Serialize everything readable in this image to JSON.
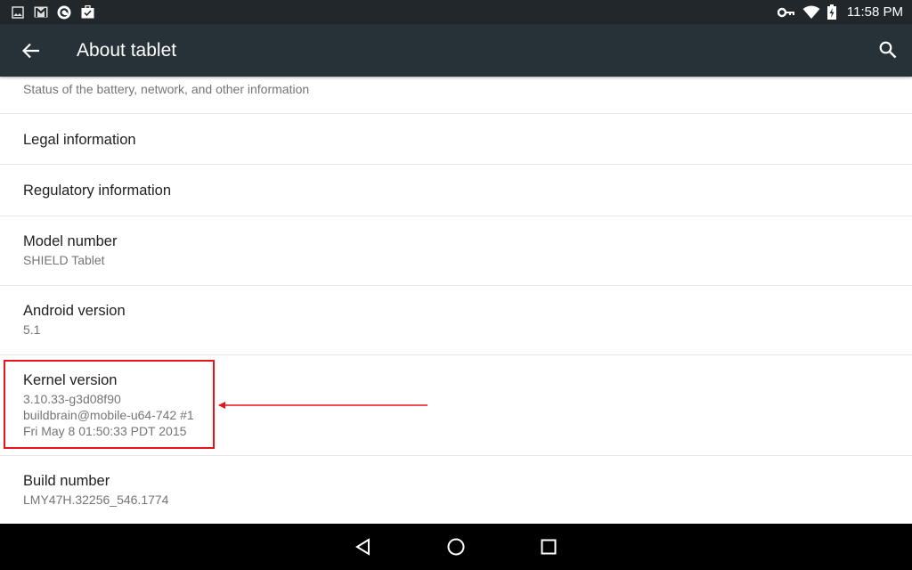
{
  "status_bar": {
    "left_icons": [
      "image-icon",
      "gmail-icon",
      "sync-circle-icon",
      "briefcase-check-icon"
    ],
    "right_icons": [
      "vpn-key-icon",
      "wifi-icon",
      "battery-charging-icon"
    ],
    "time": "11:58 PM"
  },
  "app_bar": {
    "title": "About tablet",
    "back_icon": "arrow-back-icon",
    "search_icon": "search-icon"
  },
  "list": {
    "items": [
      {
        "title": "",
        "subtitle": "Status of the battery, network, and other information"
      },
      {
        "title": "Legal information",
        "subtitle": ""
      },
      {
        "title": "Regulatory information",
        "subtitle": ""
      },
      {
        "title": "Model number",
        "subtitle": "SHIELD Tablet"
      },
      {
        "title": "Android version",
        "subtitle": "5.1"
      },
      {
        "title": "Kernel version",
        "subtitle_lines": [
          "3.10.33-g3d08f90",
          "buildbrain@mobile-u64-742 #1",
          "Fri May 8 01:50:33 PDT 2015"
        ]
      },
      {
        "title": "Build number",
        "subtitle": "LMY47H.32256_546.1774"
      }
    ]
  },
  "annotation": {
    "highlight_color": "#e8141a",
    "target": "Kernel version"
  },
  "nav_bar": {
    "buttons": [
      "back-triangle-icon",
      "home-circle-icon",
      "recents-square-icon"
    ]
  }
}
